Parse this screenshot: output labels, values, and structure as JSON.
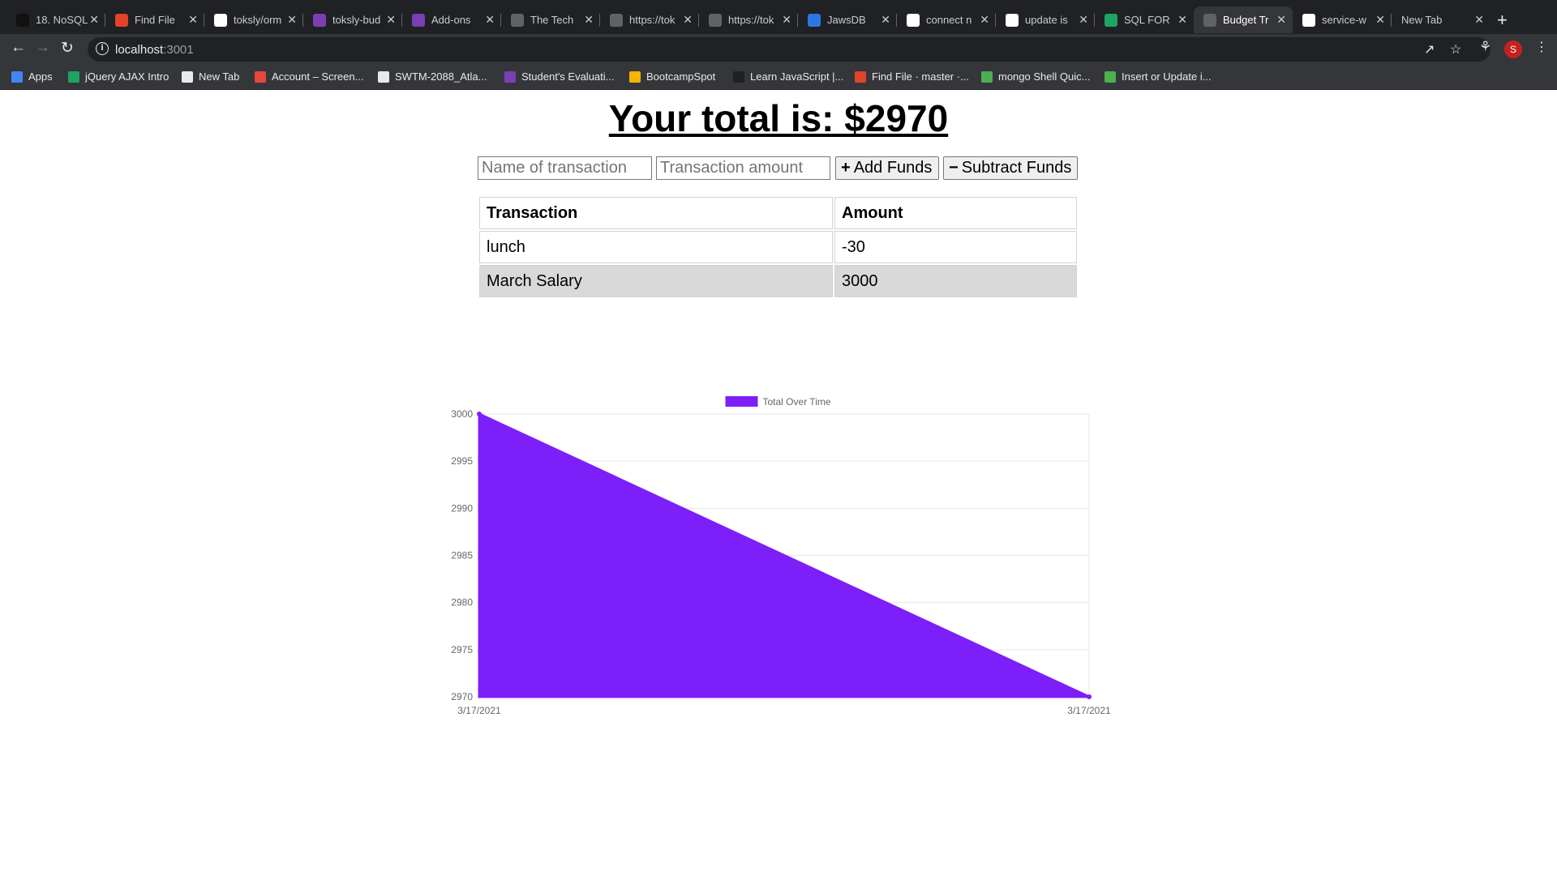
{
  "browser": {
    "tabs": [
      {
        "title": "18. NoSQL",
        "color": "#111111"
      },
      {
        "title": "Find File",
        "color": "#e24329"
      },
      {
        "title": "toksly/orm",
        "color": "#ffffff"
      },
      {
        "title": "toksly-bud",
        "color": "#7b3fb5"
      },
      {
        "title": "Add-ons",
        "color": "#7b3fb5"
      },
      {
        "title": "The Tech",
        "color": "#5f6368"
      },
      {
        "title": "https://tok",
        "color": "#5f6368"
      },
      {
        "title": "https://tok",
        "color": "#5f6368"
      },
      {
        "title": "JawsDB",
        "color": "#2b78e4"
      },
      {
        "title": "connect n",
        "color": "#ffffff"
      },
      {
        "title": "update is",
        "color": "#ffffff"
      },
      {
        "title": "SQL FOR",
        "color": "#1da462"
      },
      {
        "title": "Budget Tr",
        "color": "#5f6368",
        "active": true
      },
      {
        "title": "service-w",
        "color": "#ffffff"
      },
      {
        "title": "New Tab",
        "color": "none"
      }
    ],
    "url_host": "localhost",
    "url_port": ":3001",
    "profile_initial": "S",
    "bookmarks": [
      "Apps",
      "jQuery AJAX Intro",
      "New Tab",
      "Account – Screen...",
      "SWTM-2088_Atla...",
      "Student's Evaluati...",
      "BootcampSpot",
      "Learn JavaScript |...",
      "Find File · master ·...",
      "mongo Shell Quic...",
      "Insert or Update i..."
    ]
  },
  "page": {
    "total_text": "Your total is: $2970",
    "name_placeholder": "Name of transaction",
    "amount_placeholder": "Transaction amount",
    "add_icon": "+",
    "add_label": "Add Funds",
    "subtract_icon": "−",
    "subtract_label": "Subtract Funds",
    "table": {
      "headers": [
        "Transaction",
        "Amount"
      ],
      "rows": [
        {
          "name": "lunch",
          "amount": "-30"
        },
        {
          "name": "March Salary",
          "amount": "3000"
        }
      ]
    }
  },
  "chart_data": {
    "type": "area",
    "categories": [
      "3/17/2021",
      "3/17/2021"
    ],
    "series": [
      {
        "name": "Total Over Time",
        "values": [
          3000,
          2970
        ],
        "color": "#7d1ff9"
      }
    ],
    "ylim": [
      2970,
      3000
    ],
    "yticks": [
      3000,
      2995,
      2990,
      2985,
      2980,
      2975,
      2970
    ],
    "legend": "top",
    "grid": true
  }
}
